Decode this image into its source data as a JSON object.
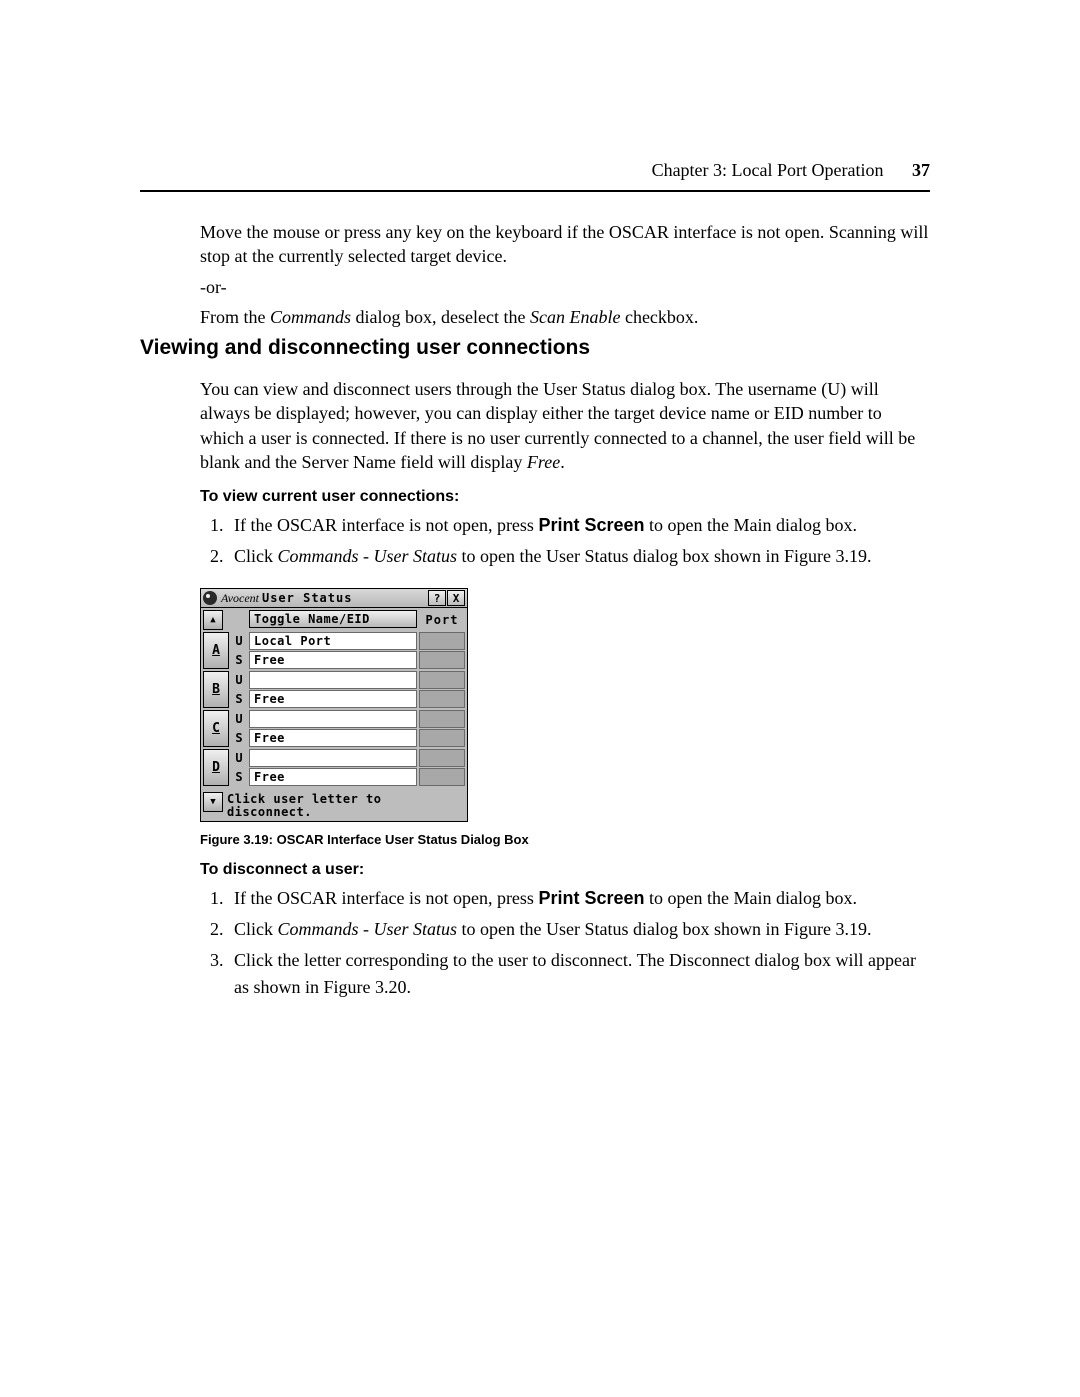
{
  "header": {
    "chapter_line": "Chapter 3: Local Port Operation",
    "page_number": "37"
  },
  "body": {
    "p1a": "Move the mouse or press any key on the keyboard if the OSCAR interface is not open. Scanning will stop at the currently selected target device.",
    "or": "-or-",
    "p1b_pre": "From the ",
    "p1b_cmd": "Commands",
    "p1b_mid": " dialog box, deselect the ",
    "p1b_scan": "Scan Enable",
    "p1b_post": " checkbox.",
    "h2": "Viewing and disconnecting user connections",
    "p2": "You can view and disconnect users through the User Status dialog box. The username (U) will always be displayed; however, you can display either the target device name or EID number to which a user is connected. If there is no user currently connected to a channel, the user field will be blank and the Server Name field will display ",
    "p2_free": "Free",
    "p2_dot": ".",
    "h3a": "To view current user connections:",
    "step_a1_pre": "If the OSCAR interface is not open, press ",
    "step_a1_ps": "Print Screen",
    "step_a1_post": " to open the Main dialog box.",
    "step_a2_pre": "Click ",
    "step_a2_cmd": "Commands - User Status",
    "step_a2_post": " to open the User Status dialog box shown in Figure 3.19.",
    "figcap": "Figure 3.19: OSCAR Interface User Status Dialog Box",
    "h3b": "To disconnect a user:",
    "step_b3": "Click the letter corresponding to the user to disconnect. The Disconnect dialog box will appear as shown in Figure 3.20."
  },
  "oscar": {
    "brand": "Avocent",
    "title": "User Status",
    "help_btn": "?",
    "close_btn": "X",
    "up_glyph": "▲",
    "down_glyph": "▼",
    "toggle_label": "Toggle Name/EID",
    "port_label": "Port",
    "U": "U",
    "S": "S",
    "rows": [
      {
        "letter": "A",
        "u": "Local Port",
        "s": "Free"
      },
      {
        "letter": "B",
        "u": "",
        "s": "Free"
      },
      {
        "letter": "C",
        "u": "",
        "s": "Free"
      },
      {
        "letter": "D",
        "u": "",
        "s": "Free"
      }
    ],
    "help_line1": "Click user letter to",
    "help_line2": "disconnect."
  }
}
